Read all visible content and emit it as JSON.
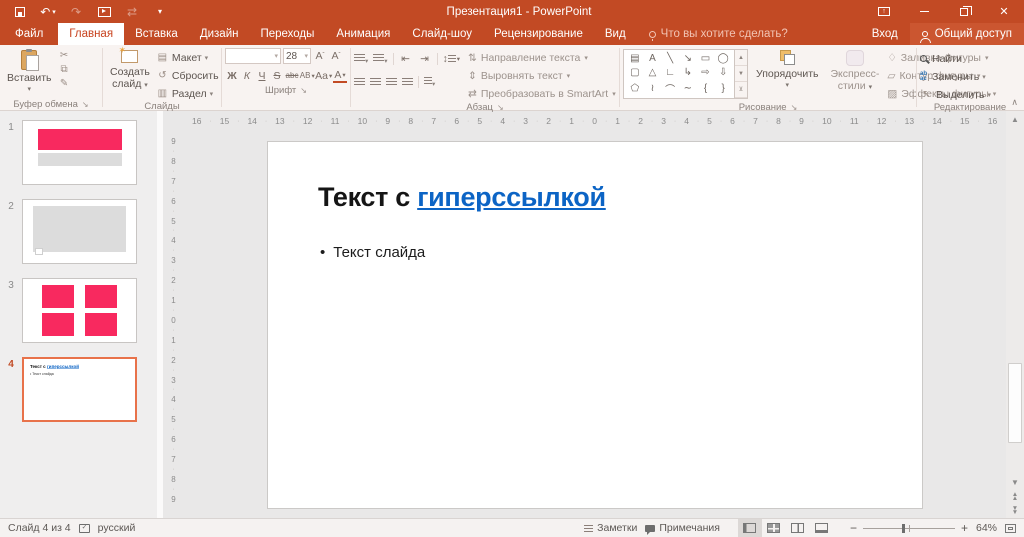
{
  "titlebar": {
    "title": "Презентация1 - PowerPoint"
  },
  "tabs": {
    "items": [
      {
        "id": "file",
        "label": "Файл",
        "file": true
      },
      {
        "id": "home",
        "label": "Главная",
        "active": true
      },
      {
        "id": "insert",
        "label": "Вставка"
      },
      {
        "id": "design",
        "label": "Дизайн"
      },
      {
        "id": "transitions",
        "label": "Переходы"
      },
      {
        "id": "animations",
        "label": "Анимация"
      },
      {
        "id": "slideshow",
        "label": "Слайд-шоу"
      },
      {
        "id": "review",
        "label": "Рецензирование"
      },
      {
        "id": "view",
        "label": "Вид"
      }
    ],
    "tell_me": "Что вы хотите сделать?",
    "sign_in": "Вход",
    "share": "Общий доступ"
  },
  "ribbon": {
    "clipboard": {
      "paste": "Вставить",
      "label": "Буфер обмена"
    },
    "slides": {
      "new_slide_line1": "Создать",
      "new_slide_line2": "слайд",
      "layout": "Макет",
      "reset": "Сбросить",
      "section": "Раздел",
      "label": "Слайды"
    },
    "font": {
      "size": "28",
      "bold": "Ж",
      "italic": "К",
      "underline": "Ч",
      "strike": "S",
      "strike_small": "abc",
      "spacing": "АВ",
      "case": "Aa",
      "color": "А",
      "label": "Шрифт"
    },
    "paragraph": {
      "text_direction": "Направление текста",
      "align_text": "Выровнять текст",
      "smartart": "Преобразовать в SmartArt",
      "label": "Абзац"
    },
    "drawing": {
      "arrange": "Упорядочить",
      "quick1": "Экспресс-",
      "quick2": "стили",
      "fill": "Заливка фигуры",
      "outline": "Контур фигуры",
      "effects": "Эффекты фигуры",
      "label": "Рисование",
      "shapes": [
        {
          "name": "recent-shapes",
          "g": "▤"
        },
        {
          "name": "text-box",
          "g": "A"
        },
        {
          "name": "line",
          "g": "╲"
        },
        {
          "name": "line-arrow",
          "g": "↘"
        },
        {
          "name": "rectangle",
          "g": "▭"
        },
        {
          "name": "oval",
          "g": "◯"
        },
        {
          "name": "rounded-rectangle",
          "g": "▢"
        },
        {
          "name": "triangle",
          "g": "△"
        },
        {
          "name": "elbow-connector",
          "g": "∟"
        },
        {
          "name": "elbow-arrow-connector",
          "g": "↳"
        },
        {
          "name": "right-arrow",
          "g": "⇨"
        },
        {
          "name": "down-arrow",
          "g": "⇩"
        },
        {
          "name": "freeform",
          "g": "⬠"
        },
        {
          "name": "scribble",
          "g": "≀"
        },
        {
          "name": "arc",
          "g": "⌒"
        },
        {
          "name": "curve",
          "g": "∼"
        },
        {
          "name": "left-brace",
          "g": "{"
        },
        {
          "name": "right-brace",
          "g": "}"
        }
      ]
    },
    "editing": {
      "find": "Найти",
      "replace": "Заменить",
      "select": "Выделить",
      "label": "Редактирование"
    }
  },
  "slide_panel": {
    "slides": [
      {
        "number": "1"
      },
      {
        "number": "2"
      },
      {
        "number": "3"
      },
      {
        "number": "4"
      }
    ],
    "slide4_title_plain": "Текст с ",
    "slide4_title_link": "гиперссылкой",
    "slide4_bullet": "• Текст слайда"
  },
  "rulers": {
    "h": [
      16,
      15,
      14,
      13,
      12,
      11,
      10,
      9,
      8,
      7,
      6,
      5,
      4,
      3,
      2,
      1,
      0,
      1,
      2,
      3,
      4,
      5,
      6,
      7,
      8,
      9,
      10,
      11,
      12,
      13,
      14,
      15,
      16
    ],
    "v": [
      9,
      8,
      7,
      6,
      5,
      4,
      3,
      2,
      1,
      0,
      1,
      2,
      3,
      4,
      5,
      6,
      7,
      8,
      9
    ]
  },
  "slide": {
    "title_plain": "Текст с ",
    "title_link": "гиперссылкой",
    "bullet_marker": "•",
    "bullet": "Текст слайда"
  },
  "statusbar": {
    "slide_info": "Слайд 4 из 4",
    "language": "русский",
    "notes": "Заметки",
    "comments": "Примечания",
    "zoom": "64%"
  },
  "colors": {
    "accent": "#C24A24",
    "pink": "#F8295F",
    "link": "#0C64C5",
    "selection": "#E8724A"
  }
}
